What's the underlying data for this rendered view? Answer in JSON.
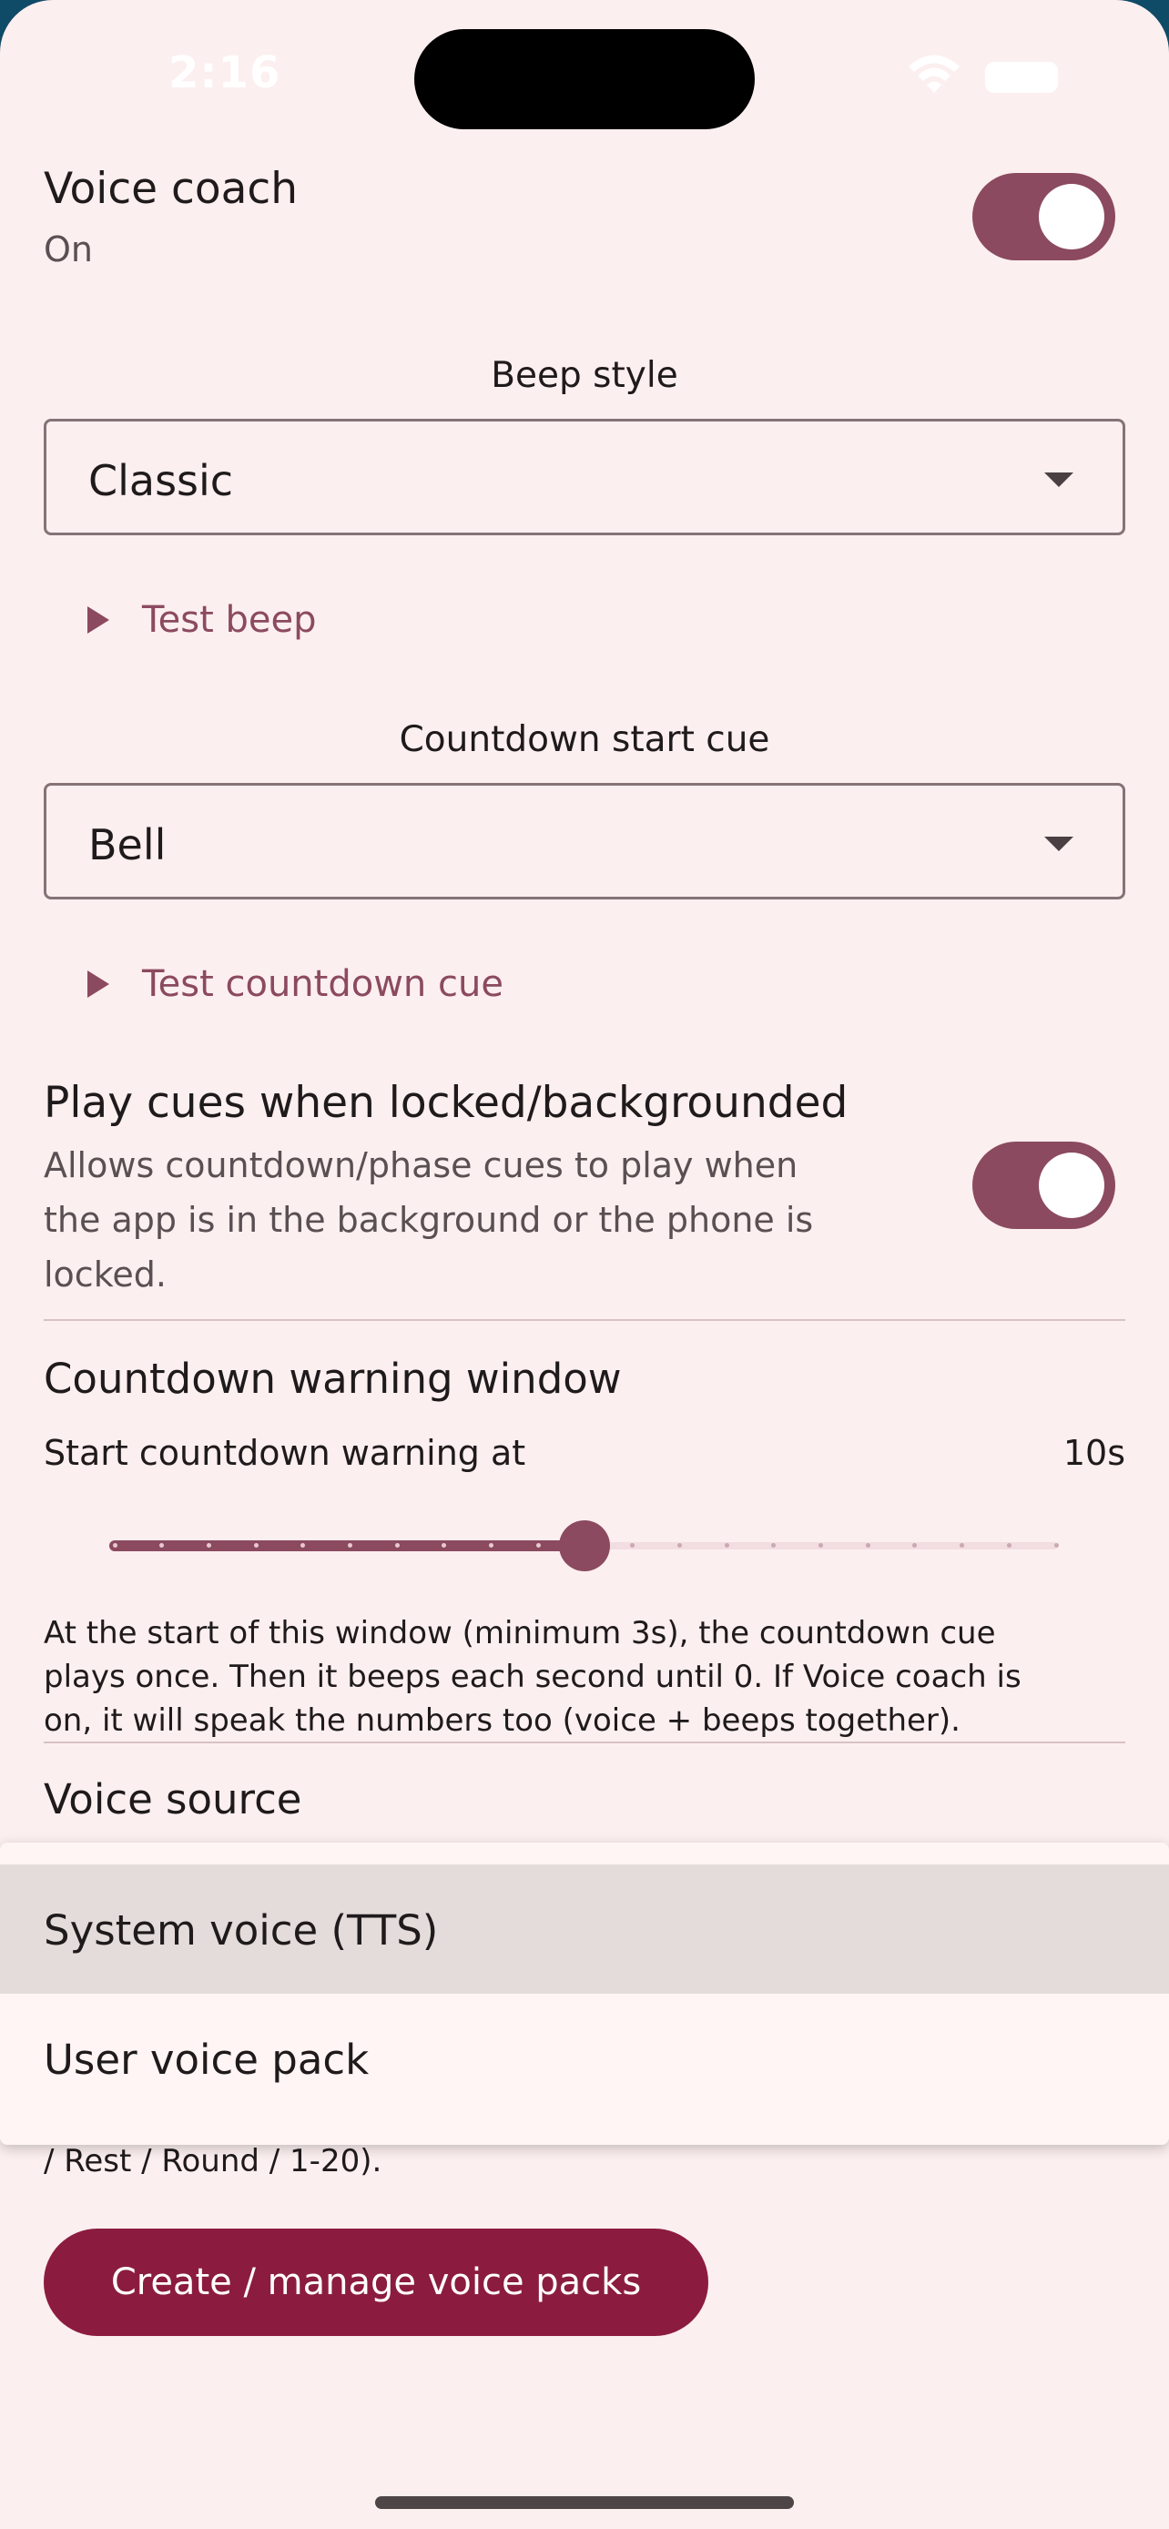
{
  "status_bar": {
    "time": "2:16"
  },
  "voice_coach": {
    "title": "Voice coach",
    "state": "On",
    "enabled": true
  },
  "beep_style": {
    "label": "Beep style",
    "value": "Classic",
    "test_label": "Test beep"
  },
  "countdown_start_cue": {
    "label": "Countdown start cue",
    "value": "Bell",
    "test_label": "Test countdown cue"
  },
  "background_cues": {
    "title": "Play cues when locked/backgrounded",
    "description_lines": [
      "Allows countdown/phase cues to play when",
      "the app is in the background or the phone is",
      "locked."
    ],
    "enabled": true
  },
  "countdown_warning": {
    "section_title": "Countdown warning window",
    "slider_label": "Start countdown warning at",
    "value_text": "10s",
    "slider_fraction": 0.5,
    "description_lines": [
      "At the start of this window (minimum 3s), the countdown cue",
      "plays once. Then it beeps each second until 0. If Voice coach is",
      "on, it will speak the numbers too (voice + beeps together)."
    ]
  },
  "voice_source": {
    "section_title": "Voice source",
    "options": [
      "System voice (TTS)",
      "User voice pack"
    ],
    "selected": "System voice (TTS)",
    "partial_text": "/ Rest / Round / 1-20)."
  },
  "manage_button": {
    "label": "Create / manage voice packs"
  },
  "colors": {
    "accent": "#8b4a5f",
    "primary_button": "#8b1c3f",
    "background": "#fcefef",
    "menu_selected": "#e3dcda"
  }
}
